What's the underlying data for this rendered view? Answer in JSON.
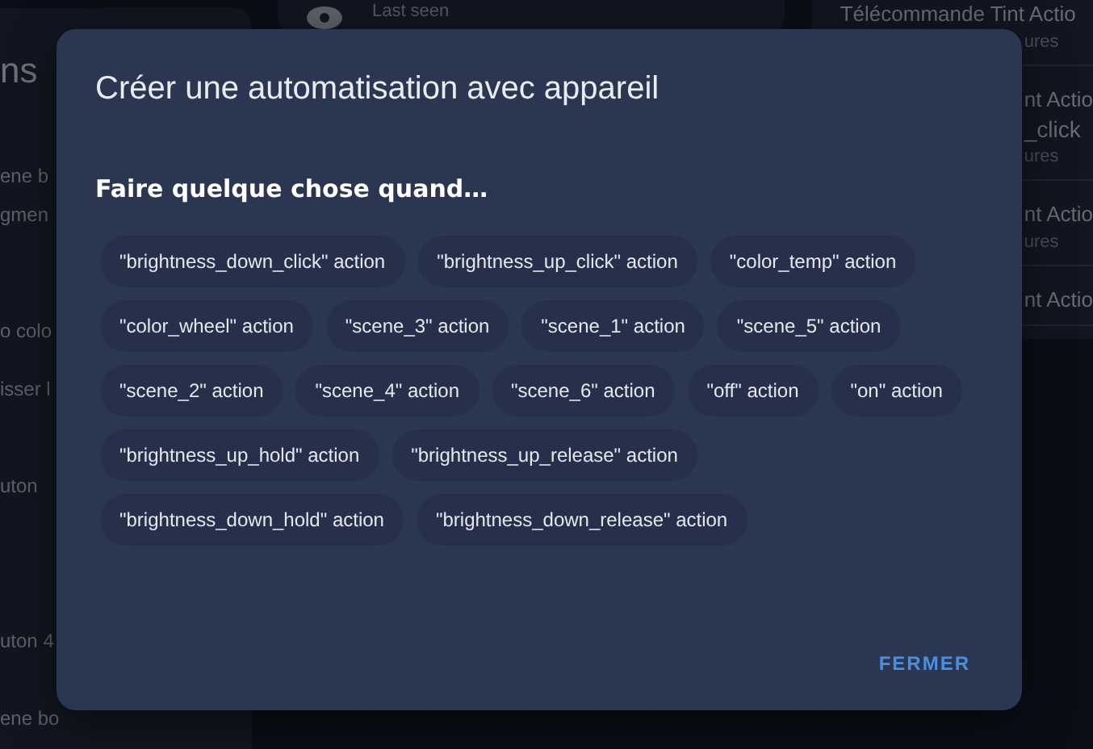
{
  "background": {
    "left_panel": {
      "title": "ns",
      "items": [
        "ene b",
        "gmen",
        "o colo",
        "isser l",
        "uton",
        "uton 4",
        "ene bo"
      ]
    },
    "top_card": {
      "label": "Last seen"
    },
    "right_panel": {
      "items": [
        {
          "title": "Télécommande Tint Actio",
          "subtitle": "ures"
        },
        {
          "title": "nt Actio",
          "line2": "_click",
          "subtitle": "ures"
        },
        {
          "title": "nt Actio",
          "subtitle": "ures"
        },
        {
          "title": "nt Actio"
        }
      ]
    }
  },
  "dialog": {
    "title": "Créer une automatisation avec appareil",
    "heading": "Faire quelque chose quand…",
    "chips": [
      "\"brightness_down_click\" action",
      "\"brightness_up_click\" action",
      "\"color_temp\" action",
      "\"color_wheel\" action",
      "\"scene_3\" action",
      "\"scene_1\" action",
      "\"scene_5\" action",
      "\"scene_2\" action",
      "\"scene_4\" action",
      "\"scene_6\" action",
      "\"off\" action",
      "\"on\" action",
      "\"brightness_up_hold\" action",
      "\"brightness_up_release\" action",
      "\"brightness_down_hold\" action",
      "\"brightness_down_release\" action"
    ],
    "buttons": [
      "FERMER"
    ]
  }
}
